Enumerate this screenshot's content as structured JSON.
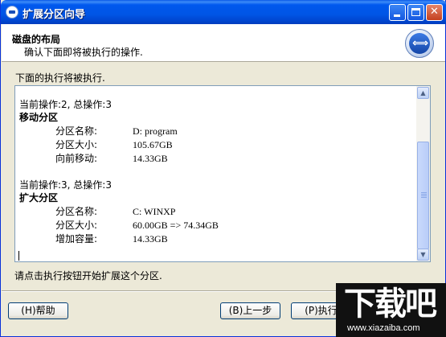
{
  "window": {
    "title": "扩展分区向导",
    "buttons": {
      "minimize": "_",
      "maximize": "□",
      "close": "✕"
    }
  },
  "header": {
    "title": "磁盘的布局",
    "subtitle": "确认下面即将被执行的操作."
  },
  "description": "下面的执行将被执行.",
  "operations": [
    {
      "line": "当前操作:2, 总操作:3",
      "title": "移动分区",
      "fields": [
        {
          "key": "分区名称:",
          "value": "D: program"
        },
        {
          "key": "分区大小:",
          "value": "105.67GB"
        },
        {
          "key": "向前移动:",
          "value": "14.33GB"
        }
      ]
    },
    {
      "line": "当前操作:3, 总操作:3",
      "title": "扩大分区",
      "fields": [
        {
          "key": "分区名称:",
          "value": "C: WINXP"
        },
        {
          "key": "分区大小:",
          "value": "60.00GB => 74.34GB"
        },
        {
          "key": "增加容量:",
          "value": "14.33GB"
        }
      ]
    }
  ],
  "scrollbar": {
    "up": "▲",
    "down": "▼",
    "grip": "≡"
  },
  "hint": "请点击执行按钮开始扩展这个分区.",
  "footer": {
    "help_label": "(H)帮助",
    "back_label": "(B)上一步",
    "execute_label": "(P)执行"
  },
  "watermark": {
    "big": "下载吧",
    "small": "www.xiazaiba.com"
  },
  "colors": {
    "title_bar": "#0055e5",
    "dialog_bg": "#ece9d8",
    "border": "#7f9db9"
  }
}
